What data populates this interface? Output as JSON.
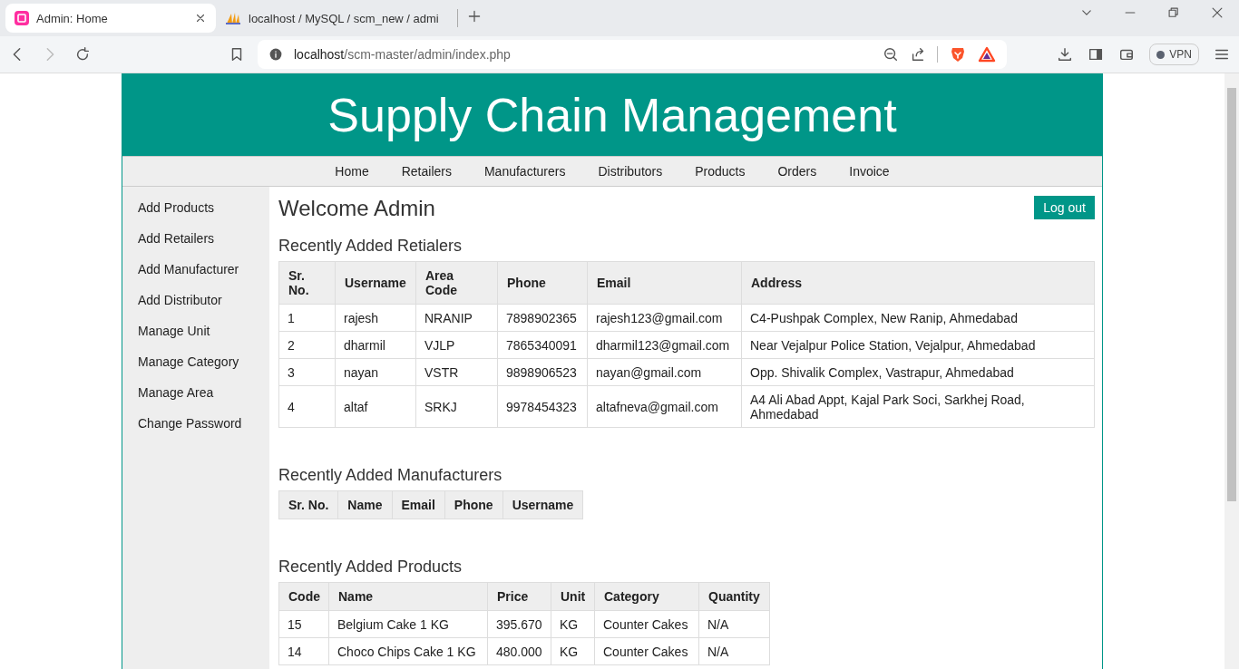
{
  "browser": {
    "tabs": [
      {
        "title": "Admin: Home",
        "selected": true,
        "kind": "app"
      },
      {
        "title": "localhost / MySQL / scm_new / admi",
        "selected": false,
        "kind": "pma"
      }
    ],
    "address": {
      "host": "localhost",
      "path": "/scm-master/admin/index.php"
    },
    "vpn": "VPN"
  },
  "site": {
    "title": "Supply Chain Management",
    "nav": [
      "Home",
      "Retailers",
      "Manufacturers",
      "Distributors",
      "Products",
      "Orders",
      "Invoice"
    ],
    "sidebar": [
      "Add Products",
      "Add Retailers",
      "Add Manufacturer",
      "Add Distributor",
      "Manage Unit",
      "Manage Category",
      "Manage Area",
      "Change Password"
    ],
    "welcome": "Welcome Admin",
    "logout": "Log out",
    "sections": [
      {
        "heading": "Recently Added Retialers",
        "columns": [
          "Sr. No.",
          "Username",
          "Area Code",
          "Phone",
          "Email",
          "Address"
        ],
        "rows": [
          [
            "1",
            "rajesh",
            "NRANIP",
            "7898902365",
            "rajesh123@gmail.com",
            "C4-Pushpak Complex, New Ranip, Ahmedabad"
          ],
          [
            "2",
            "dharmil",
            "VJLP",
            "7865340091",
            "dharmil123@gmail.com",
            "Near Vejalpur Police Station, Vejalpur, Ahmedabad"
          ],
          [
            "3",
            "nayan",
            "VSTR",
            "9898906523",
            "nayan@gmail.com",
            "Opp. Shivalik Complex, Vastrapur, Ahmedabad"
          ],
          [
            "4",
            "altaf",
            "SRKJ",
            "9978454323",
            "altafneva@gmail.com",
            "A4 Ali Abad Appt, Kajal Park Soci, Sarkhej Road, Ahmedabad"
          ]
        ]
      },
      {
        "heading": "Recently Added Manufacturers",
        "columns": [
          "Sr. No.",
          "Name",
          "Email",
          "Phone",
          "Username"
        ]
      },
      {
        "heading": "Recently Added Products",
        "columns": [
          "Code",
          "Name",
          "Price",
          "Unit",
          "Category",
          "Quantity"
        ],
        "rows": [
          [
            "15",
            "Belgium Cake 1 KG",
            "395.670",
            "KG",
            "Counter Cakes",
            "N/A"
          ],
          [
            "14",
            "Choco Chips Cake 1 KG",
            "480.000",
            "KG",
            "Counter Cakes",
            "N/A"
          ]
        ]
      }
    ]
  }
}
